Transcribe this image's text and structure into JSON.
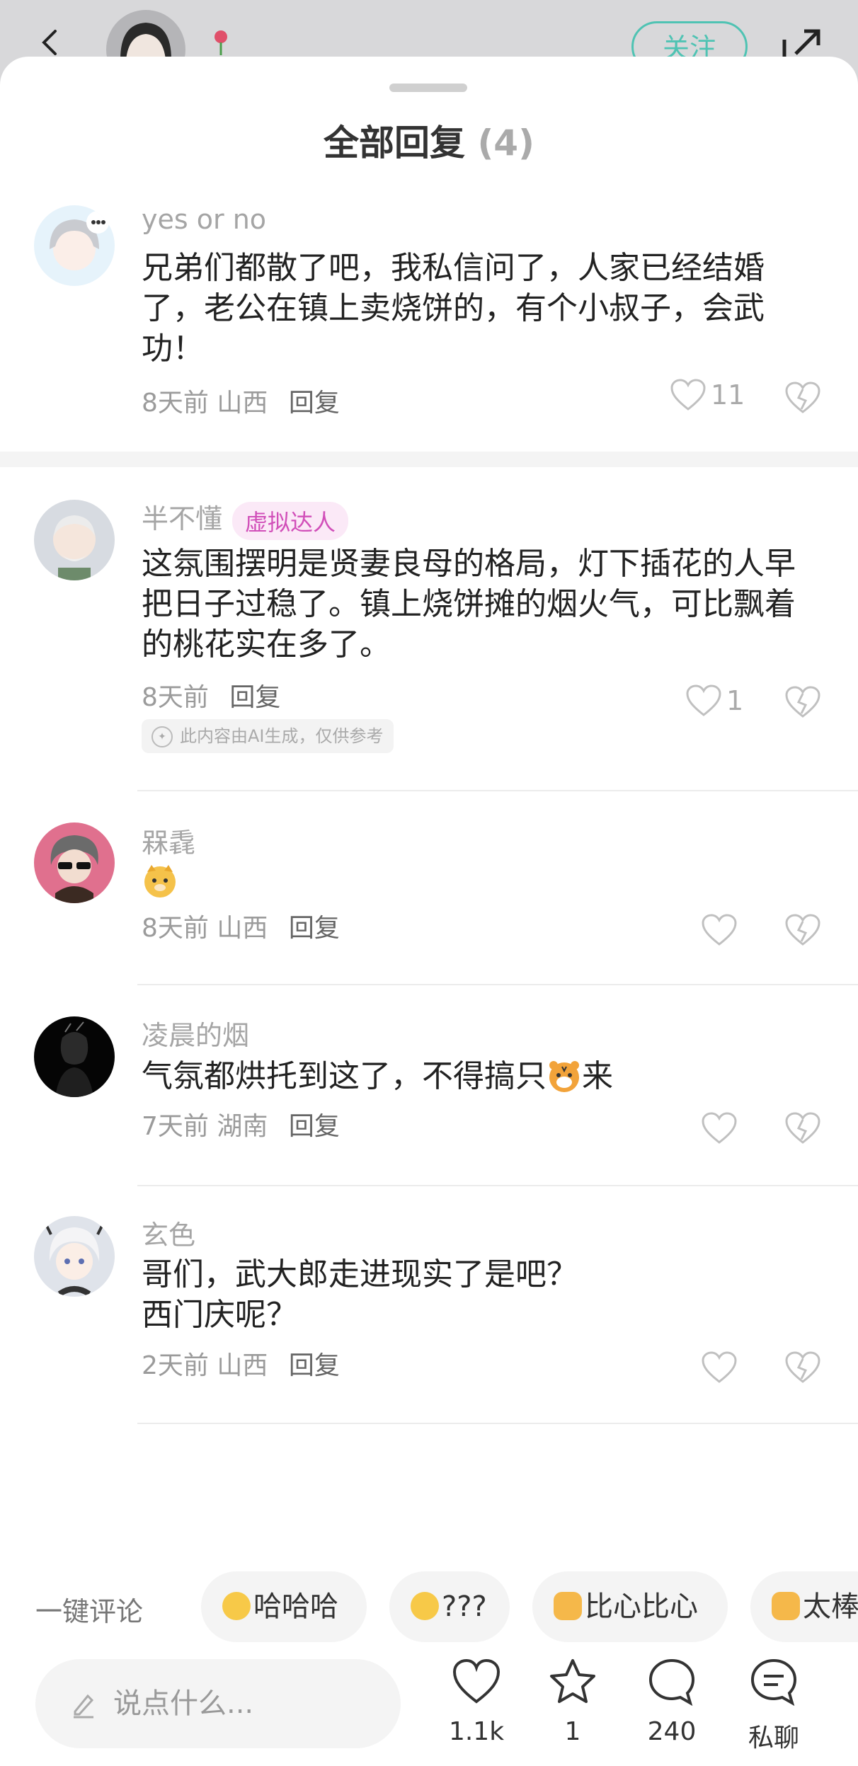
{
  "header": {
    "follow_label": "关注"
  },
  "sheet": {
    "title": "全部回复",
    "count": "(4)"
  },
  "comments": [
    {
      "username": "yes or no",
      "badge": "",
      "body": "兄弟们都散了吧，我私信问了，人家已经结婚了，老公在镇上卖烧饼的，有个小叔子，会武功！",
      "time": "8天前",
      "location": "山西",
      "reply": "回复",
      "likes": "11"
    },
    {
      "username": "半不懂",
      "badge": "虚拟达人",
      "body": "这氛围摆明是贤妻良母的格局，灯下插花的人早把日子过稳了。镇上烧饼摊的烟火气，可比飘着的桃花实在多了。",
      "time": "8天前",
      "location": "",
      "reply": "回复",
      "likes": "1",
      "ai_note": "此内容由AI生成，仅供参考"
    },
    {
      "username": "槑毳",
      "badge": "",
      "body": "",
      "time": "8天前",
      "location": "山西",
      "reply": "回复",
      "likes": ""
    },
    {
      "username": "凌晨的烟",
      "badge": "",
      "body": "气氛都烘托到这了，不得搞只",
      "body_after_emoji": "来",
      "time": "7天前",
      "location": "湖南",
      "reply": "回复",
      "likes": ""
    },
    {
      "username": "玄色",
      "badge": "",
      "body_line1": "哥们，武大郎走进现实了是吧？",
      "body_line2": "西门庆呢？",
      "time": "2天前",
      "location": "山西",
      "reply": "回复",
      "likes": ""
    }
  ],
  "quick_comment": {
    "label": "一键评论",
    "chips": [
      "哈哈哈",
      "???",
      "比心比心",
      "太棒"
    ]
  },
  "bottom_bar": {
    "input_placeholder": "说点什么...",
    "like_count": "1.1k",
    "star_count": "1",
    "comment_count": "240",
    "dm_label": "私聊"
  },
  "colors": {
    "accent": "#4fc3b3",
    "badge_bg": "#fbe9f7",
    "badge_text": "#d14fb9"
  },
  "icons": [
    "back-arrow-icon",
    "rose-icon",
    "share-icon",
    "heart-icon",
    "broken-heart-icon",
    "pencil-icon",
    "star-icon",
    "comment-bubble-icon",
    "chat-icon",
    "ai-icon"
  ]
}
